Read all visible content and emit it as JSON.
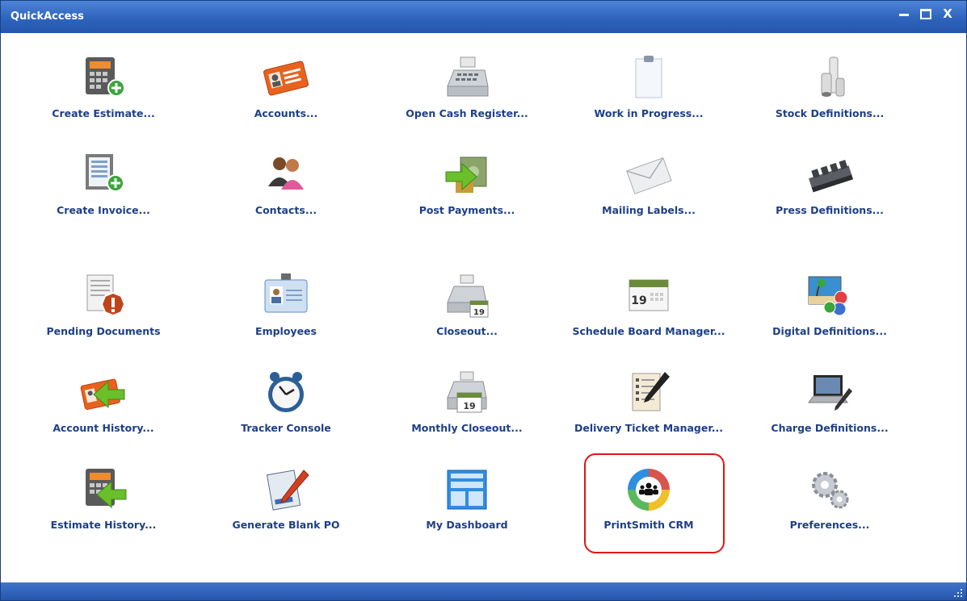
{
  "window": {
    "title": "QuickAccess",
    "controls": [
      "minimize",
      "maximize",
      "close"
    ],
    "close_label": "X"
  },
  "items": [
    {
      "label": "Create Estimate...",
      "icon": "calculator-add-icon"
    },
    {
      "label": "Accounts...",
      "icon": "id-card-icon"
    },
    {
      "label": "Open Cash Register...",
      "icon": "cash-register-icon"
    },
    {
      "label": "Work in Progress...",
      "icon": "clipboard-icon"
    },
    {
      "label": "Stock Definitions...",
      "icon": "paper-rolls-icon"
    },
    {
      "label": "Create Invoice...",
      "icon": "invoice-add-icon"
    },
    {
      "label": "Contacts...",
      "icon": "people-icon"
    },
    {
      "label": "Post Payments...",
      "icon": "payment-arrow-icon"
    },
    {
      "label": "Mailing Labels...",
      "icon": "envelope-icon"
    },
    {
      "label": "Press Definitions...",
      "icon": "printing-press-icon"
    },
    {
      "label": "Pending Documents",
      "icon": "document-warning-icon"
    },
    {
      "label": "Employees",
      "icon": "employee-badge-icon"
    },
    {
      "label": "Closeout...",
      "icon": "register-calendar-icon"
    },
    {
      "label": "Schedule Board Manager...",
      "icon": "calendar-icon"
    },
    {
      "label": "Digital Definitions...",
      "icon": "digital-media-icon"
    },
    {
      "label": "Account History...",
      "icon": "card-history-icon"
    },
    {
      "label": "Tracker Console",
      "icon": "alarm-clock-icon"
    },
    {
      "label": "Monthly Closeout...",
      "icon": "register-month-icon"
    },
    {
      "label": "Delivery Ticket Manager...",
      "icon": "checklist-pen-icon"
    },
    {
      "label": "Charge Definitions...",
      "icon": "laptop-pen-icon"
    },
    {
      "label": "Estimate History...",
      "icon": "calculator-history-icon"
    },
    {
      "label": "Generate Blank PO",
      "icon": "form-pen-icon"
    },
    {
      "label": "My Dashboard",
      "icon": "dashboard-icon"
    },
    {
      "label": "PrintSmith CRM",
      "icon": "crm-cycle-icon"
    },
    {
      "label": "Preferences...",
      "icon": "gears-icon"
    }
  ],
  "highlighted_item": "PrintSmith CRM",
  "colors": {
    "titlebar": "#2f64bd",
    "label_text": "#1d3f88",
    "highlight_border": "#e01414"
  }
}
